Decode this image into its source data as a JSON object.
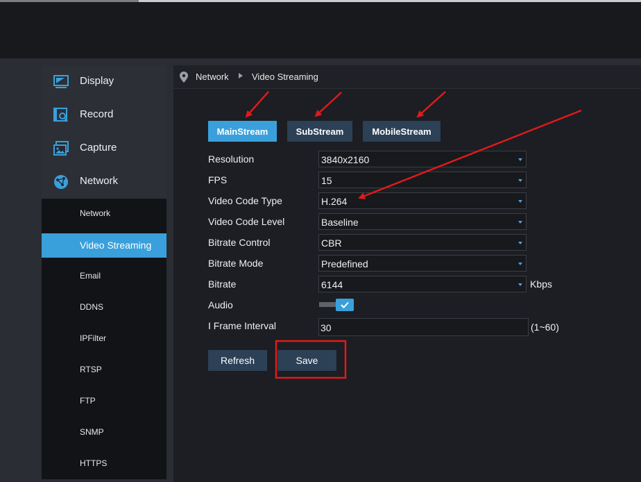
{
  "sidebar": {
    "main_items": [
      {
        "label": "Display",
        "icon": "monitor-icon"
      },
      {
        "label": "Record",
        "icon": "record-icon"
      },
      {
        "label": "Capture",
        "icon": "capture-icon"
      },
      {
        "label": "Network",
        "icon": "network-globe-icon"
      }
    ],
    "sub_items": [
      {
        "label": "Network"
      },
      {
        "label": "Video Streaming",
        "active": true
      },
      {
        "label": "Email"
      },
      {
        "label": "DDNS"
      },
      {
        "label": "IPFilter"
      },
      {
        "label": "RTSP"
      },
      {
        "label": "FTP"
      },
      {
        "label": "SNMP"
      },
      {
        "label": "HTTPS"
      }
    ]
  },
  "breadcrumb": {
    "icon": "location-pin-icon",
    "parent": "Network",
    "current": "Video Streaming"
  },
  "tabs": [
    {
      "label": "MainStream",
      "active": true
    },
    {
      "label": "SubStream",
      "active": false
    },
    {
      "label": "MobileStream",
      "active": false
    }
  ],
  "form": {
    "resolution": {
      "label": "Resolution",
      "value": "3840x2160"
    },
    "fps": {
      "label": "FPS",
      "value": "15"
    },
    "video_code_type": {
      "label": "Video Code Type",
      "value": "H.264"
    },
    "video_code_level": {
      "label": "Video Code Level",
      "value": "Baseline"
    },
    "bitrate_control": {
      "label": "Bitrate Control",
      "value": "CBR"
    },
    "bitrate_mode": {
      "label": "Bitrate Mode",
      "value": "Predefined"
    },
    "bitrate": {
      "label": "Bitrate",
      "value": "6144",
      "unit": "Kbps"
    },
    "audio": {
      "label": "Audio",
      "enabled": true
    },
    "i_frame_interval": {
      "label": "I Frame Interval",
      "value": "30",
      "range": "(1~60)"
    }
  },
  "buttons": {
    "refresh": "Refresh",
    "save": "Save"
  },
  "colors": {
    "accent": "#3aa0dc",
    "button": "#2c4056",
    "annotation": "#e01a1a"
  }
}
